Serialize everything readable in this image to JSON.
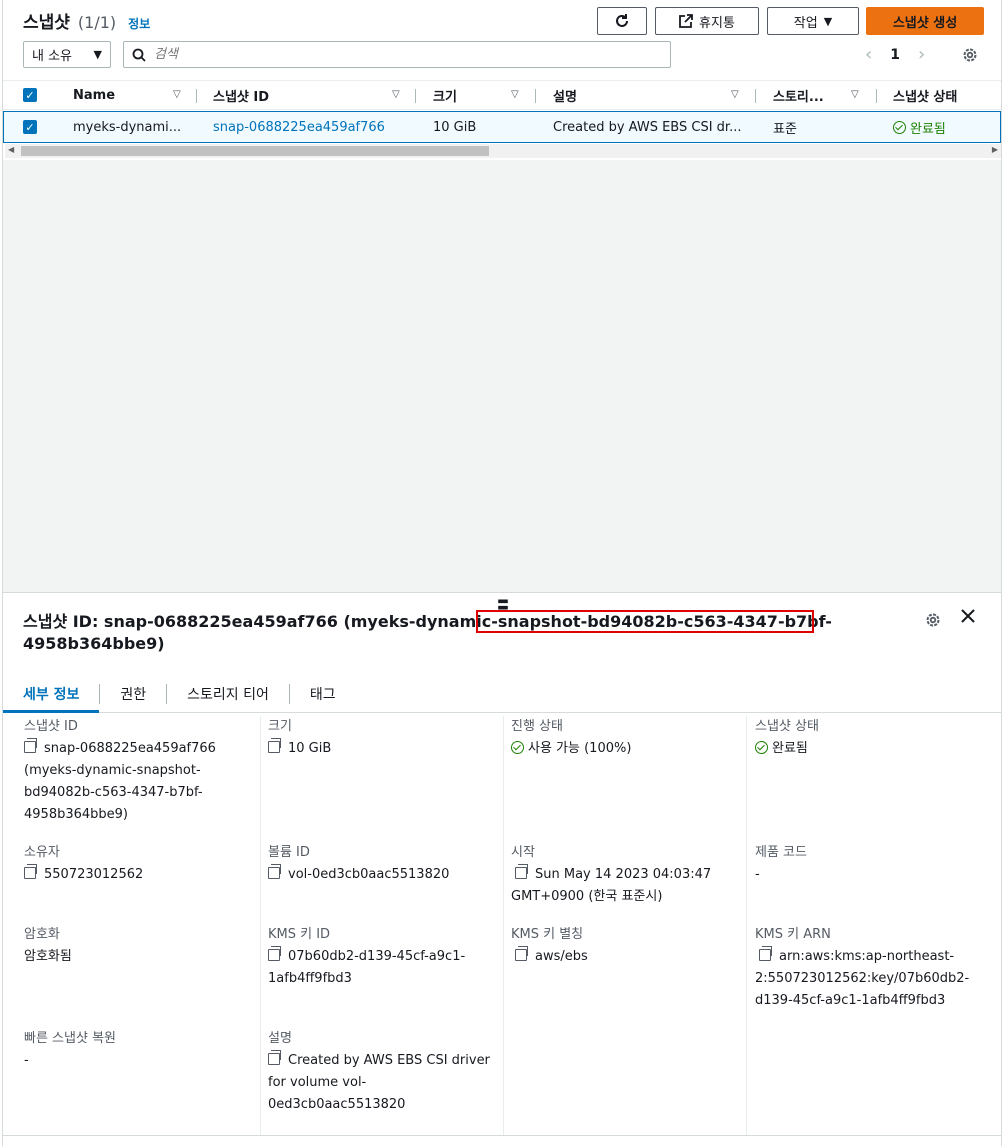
{
  "header": {
    "title": "스냅샷",
    "count": "(1/1)",
    "info": "정보",
    "refresh_icon": "refresh-icon",
    "recycle_label": "휴지통",
    "actions_label": "작업",
    "create_label": "스냅샷 생성"
  },
  "filter": {
    "owner_value": "내 소유",
    "search_placeholder": "검색"
  },
  "pager": {
    "prev": "‹",
    "page": "1",
    "next": "›"
  },
  "table": {
    "columns": [
      "Name",
      "스냅샷 ID",
      "크기",
      "설명",
      "스토리...",
      "스냅샷 상태"
    ],
    "rows": [
      {
        "name": "myeks-dynami...",
        "snapshot_id": "snap-0688225ea459af766",
        "size": "10 GiB",
        "description": "Created by AWS EBS CSI dr...",
        "storage": "표준",
        "status": "완료됨"
      }
    ]
  },
  "detail": {
    "title_prefix": "스냅샷 ID: snap-0688225ea459af766 (myeks-dynamic-snapshot-bd94082b-c563-4347-b7bf-",
    "title_suffix": "4958b364bbe9)",
    "tabs": [
      "세부 정보",
      "권한",
      "스토리지 티어",
      "태그"
    ],
    "fields": {
      "snapshot_id_label": "스냅샷 ID",
      "snapshot_id_line1": "snap-0688225ea459af766",
      "snapshot_id_line2": "(myeks-dynamic-snapshot-",
      "snapshot_id_line3": "bd94082b-c563-4347-b7bf-",
      "snapshot_id_line4": "4958b364bbe9)",
      "size_label": "크기",
      "size_value": "10 GiB",
      "progress_label": "진행 상태",
      "progress_value": "사용 가능 (100%)",
      "state_label": "스냅샷 상태",
      "state_value": "완료됨",
      "owner_label": "소유자",
      "owner_value": "550723012562",
      "volume_label": "볼륨 ID",
      "volume_value": "vol-0ed3cb0aac5513820",
      "start_label": "시작",
      "start_line1": "Sun May 14 2023 04:03:47",
      "start_line2": "GMT+0900 (한국 표준시)",
      "product_label": "제품 코드",
      "product_value": "-",
      "encryption_label": "암호화",
      "encryption_value": "암호화됨",
      "kms_id_label": "KMS 키 ID",
      "kms_id_line1": "07b60db2-d139-45cf-a9c1-",
      "kms_id_line2": "1afb4ff9fbd3",
      "kms_alias_label": "KMS 키 별칭",
      "kms_alias_value": "aws/ebs",
      "kms_arn_label": "KMS 키 ARN",
      "kms_arn_line1": "arn:aws:kms:ap-northeast-",
      "kms_arn_line2": "2:550723012562:key/07b60db2-",
      "kms_arn_line3": "d139-45cf-a9c1-1afb4ff9fbd3",
      "fast_restore_label": "빠른 스냅샷 복원",
      "fast_restore_value": "-",
      "desc_label": "설명",
      "desc_line1": "Created by AWS EBS CSI driver",
      "desc_line2": "for volume vol-",
      "desc_line3": "0ed3cb0aac5513820"
    }
  },
  "colors": {
    "link": "#0073bb",
    "success": "#1d8102",
    "primary_button": "#ec7211",
    "highlight_box": "#e00000"
  }
}
